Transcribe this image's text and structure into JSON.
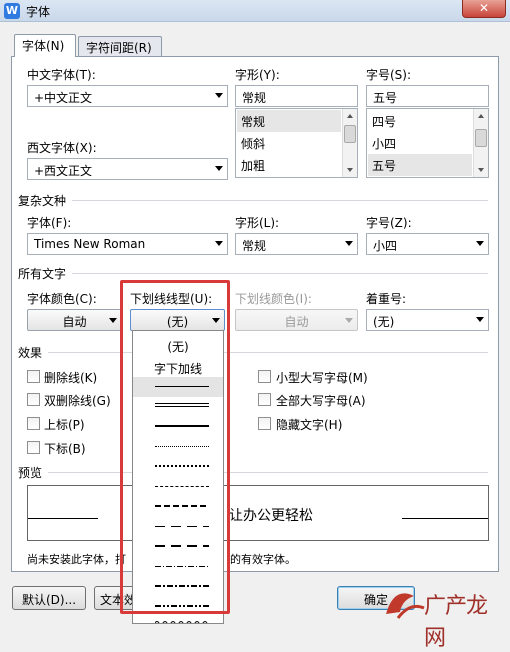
{
  "window": {
    "title": "字体",
    "app_icon_letter": "W",
    "close_glyph": "✕"
  },
  "tabs": [
    {
      "label": "字体(N)"
    },
    {
      "label": "字符间距(R)"
    }
  ],
  "chinese_font": {
    "label": "中文字体(T):",
    "value": "+中文正文"
  },
  "style": {
    "label": "字形(Y):",
    "value": "常规",
    "options": [
      "常规",
      "倾斜",
      "加粗"
    ]
  },
  "size": {
    "label": "字号(S):",
    "value": "五号",
    "options": [
      "四号",
      "小四",
      "五号"
    ]
  },
  "western_font": {
    "label": "西文字体(X):",
    "value": "+西文正文"
  },
  "complex": {
    "section_title": "复杂文种",
    "font_label": "字体(F):",
    "font_value": "Times New Roman",
    "style_label": "字形(L):",
    "style_value": "常规",
    "size_label": "字号(Z):",
    "size_value": "小四"
  },
  "all_text": {
    "section_title": "所有文字",
    "color_label": "字体颜色(C):",
    "color_value": "自动",
    "underline_label": "下划线线型(U):",
    "underline_value": "(无)",
    "underline_color_label": "下划线颜色(I):",
    "underline_color_value": "自动",
    "emphasis_label": "着重号:",
    "emphasis_value": "(无)"
  },
  "effects": {
    "section_title": "效果",
    "left": [
      "删除线(K)",
      "双删除线(G)",
      "上标(P)",
      "下标(B)"
    ],
    "right": [
      "小型大写字母(M)",
      "全部大写字母(A)",
      "隐藏文字(H)"
    ]
  },
  "preview": {
    "section_title": "预览",
    "sample_text": "让办公更轻松",
    "note_start": "尚未安装此字体，打",
    "note_end": "的有效字体。"
  },
  "buttons": {
    "default": "默认(D)...",
    "text_effect": "文本效",
    "ok": "确定"
  },
  "underline_dropdown": {
    "items": [
      "(无)",
      "字下加线"
    ],
    "selected_index": 2
  },
  "watermark": {
    "text": "广产龙网"
  }
}
